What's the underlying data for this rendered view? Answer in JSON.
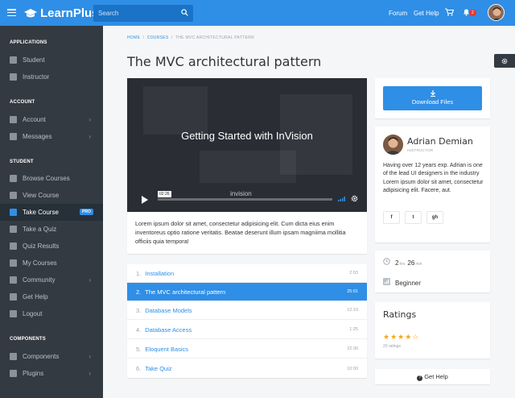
{
  "header": {
    "brand": "LearnPlus",
    "search_placeholder": "Search",
    "nav": [
      "Forum",
      "Get Help"
    ],
    "notification_count": "2",
    "accent": "#2f8ee6"
  },
  "sidebar": {
    "sections": [
      {
        "title": "APPLICATIONS",
        "items": [
          {
            "label": "Student",
            "icon": "student-icon"
          },
          {
            "label": "Instructor",
            "icon": "instructor-icon"
          }
        ]
      },
      {
        "title": "ACCOUNT",
        "items": [
          {
            "label": "Account",
            "icon": "person-icon",
            "chevron": true
          },
          {
            "label": "Messages",
            "icon": "chat-icon",
            "chevron": true
          }
        ]
      },
      {
        "title": "STUDENT",
        "items": [
          {
            "label": "Browse Courses",
            "icon": "search-icon"
          },
          {
            "label": "View Course",
            "icon": "import-icon"
          },
          {
            "label": "Take Course",
            "icon": "book-icon",
            "active": true,
            "badge": "PRO"
          },
          {
            "label": "Take a Quiz",
            "icon": "quiz-icon"
          },
          {
            "label": "Quiz Results",
            "icon": "poll-icon"
          },
          {
            "label": "My Courses",
            "icon": "library-icon"
          },
          {
            "label": "Community",
            "icon": "forum-icon",
            "chevron": true
          },
          {
            "label": "Get Help",
            "icon": "help-icon"
          },
          {
            "label": "Logout",
            "icon": "logout-icon"
          }
        ]
      },
      {
        "title": "COMPONENTS",
        "items": [
          {
            "label": "Components",
            "icon": "tune-icon",
            "chevron": true
          },
          {
            "label": "Plugins",
            "icon": "folder-icon",
            "chevron": true
          }
        ]
      }
    ]
  },
  "breadcrumb": [
    "HOME",
    "COURSES",
    "THE MVC ARCHITECTURAL PATTERN"
  ],
  "page_title": "The MVC architectural pattern",
  "video": {
    "title": "Getting Started with InVision",
    "timecode": "02:26",
    "watermark": "invision"
  },
  "description": "Lorem ipsum dolor sit amet, consectetur adipisicing elit. Cum dicta eius enim inventoreus optio ratione veritatis. Beatae deserunt illum ipsam magniima mollitia officiis quia tempora!",
  "lessons": [
    {
      "num": "1.",
      "title": "Installation",
      "duration": "2:03"
    },
    {
      "num": "2.",
      "title": "The MVC architectural pattern",
      "duration": "25:01",
      "active": true
    },
    {
      "num": "3.",
      "title": "Database Models",
      "duration": "12:10"
    },
    {
      "num": "4.",
      "title": "Database Access",
      "duration": "1:25"
    },
    {
      "num": "5.",
      "title": "Eloquent Basics",
      "duration": "22:30"
    },
    {
      "num": "6.",
      "title": "Take Quiz",
      "duration": "10:00"
    }
  ],
  "download_label": "Download Files",
  "instructor": {
    "name": "Adrian Demian",
    "role": "INSTRUCTOR",
    "bio": "Having over 12 years exp. Adrian is one of the lead UI designers in the industry Lorem ipsum dolor sit amet, consectetur adipisicing elit. Facere, aut.",
    "social": [
      "f",
      "t",
      "gh"
    ]
  },
  "course_meta": {
    "hours": "2",
    "hours_unit": "hrs",
    "minutes": "26",
    "minutes_unit": "min",
    "level": "Beginner"
  },
  "ratings": {
    "title": "Ratings",
    "stars": "★★★★☆",
    "stars_value": 4,
    "count": "20 ratings"
  },
  "help_label": "Get Help"
}
